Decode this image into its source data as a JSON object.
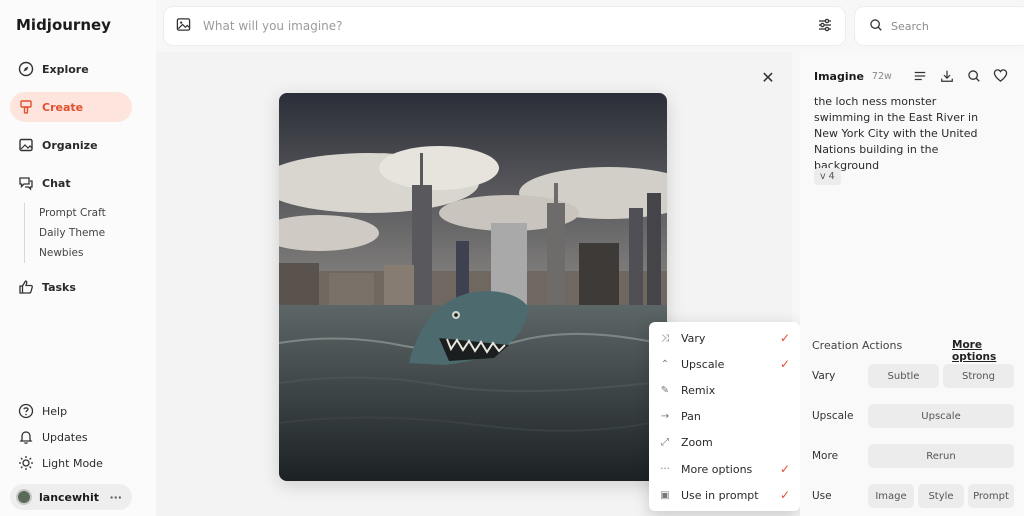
{
  "app": {
    "name": "Midjourney"
  },
  "sidebar": {
    "items": [
      {
        "label": "Explore",
        "icon": "compass-icon"
      },
      {
        "label": "Create",
        "icon": "brush-icon",
        "active": true
      },
      {
        "label": "Organize",
        "icon": "image-icon"
      },
      {
        "label": "Chat",
        "icon": "chat-icon"
      },
      {
        "label": "Tasks",
        "icon": "thumbs-up-icon"
      }
    ],
    "chat_rooms": [
      "Prompt Craft",
      "Daily Theme",
      "Newbies"
    ],
    "bottom": [
      {
        "label": "Help",
        "icon": "help-icon"
      },
      {
        "label": "Updates",
        "icon": "bell-icon"
      },
      {
        "label": "Light Mode",
        "icon": "sun-icon"
      }
    ],
    "user": {
      "name": "lancewhit",
      "menu": "···"
    }
  },
  "prompt_bar": {
    "placeholder": "What will you imagine?"
  },
  "search": {
    "placeholder": "Search"
  },
  "menu": {
    "items": [
      {
        "label": "Vary",
        "icon": "shuffle-icon",
        "checked": true
      },
      {
        "label": "Upscale",
        "icon": "upscale-icon",
        "checked": true
      },
      {
        "label": "Remix",
        "icon": "pencil-icon",
        "checked": false
      },
      {
        "label": "Pan",
        "icon": "arrow-right-icon",
        "checked": false
      },
      {
        "label": "Zoom",
        "icon": "zoom-out-icon",
        "checked": false
      },
      {
        "label": "More options",
        "icon": "ellipsis-icon",
        "checked": true
      },
      {
        "label": "Use in prompt",
        "icon": "add-image-icon",
        "checked": true
      }
    ]
  },
  "panel": {
    "title": "Imagine",
    "age": "72w",
    "prompt": "the loch ness monster swimming in the East River in New York City with the United Nations building in the background",
    "version": "v 4",
    "creation_actions": {
      "title": "Creation Actions",
      "more": "More options",
      "rows": [
        {
          "label": "Vary",
          "buttons": [
            "Subtle",
            "Strong"
          ]
        },
        {
          "label": "Upscale",
          "buttons": [
            "Upscale"
          ]
        },
        {
          "label": "More",
          "buttons": [
            "Rerun"
          ]
        },
        {
          "label": "Use",
          "buttons": [
            "Image",
            "Style",
            "Prompt"
          ]
        }
      ]
    }
  },
  "colors": {
    "accent": "#e2502f",
    "active_bg": "#fde5de"
  }
}
